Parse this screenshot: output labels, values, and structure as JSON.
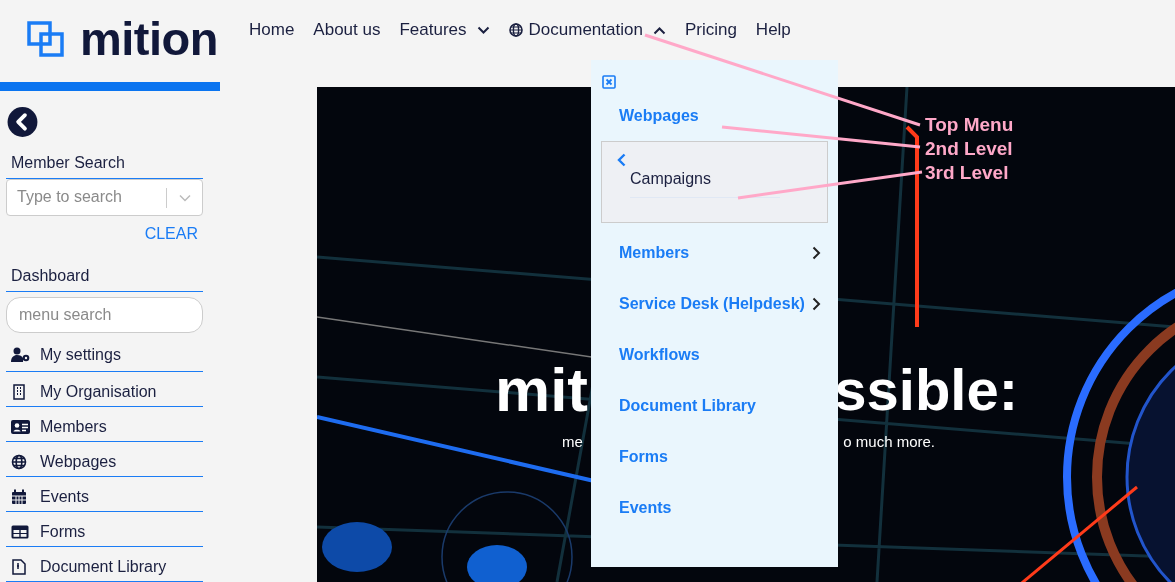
{
  "logo": {
    "text": "mition"
  },
  "nav": [
    {
      "label": "Home",
      "kind": "link"
    },
    {
      "label": "About us",
      "kind": "link"
    },
    {
      "label": "Features",
      "kind": "dropdown",
      "expanded": false
    },
    {
      "label": "Documentation",
      "kind": "globe-dropdown",
      "expanded": true
    },
    {
      "label": "Pricing",
      "kind": "link"
    },
    {
      "label": "Help",
      "kind": "link"
    }
  ],
  "sidebar": {
    "member_search": {
      "label": "Member Search",
      "placeholder": "Type to search"
    },
    "clear": "CLEAR",
    "dashboard": "Dashboard",
    "menu_search": {
      "placeholder": "menu search"
    },
    "items": [
      {
        "label": "My settings",
        "kind": "settings"
      },
      {
        "label": "My Organisation",
        "kind": "organisation"
      },
      {
        "label": "Members",
        "kind": "members"
      },
      {
        "label": "Webpages",
        "kind": "webpages"
      },
      {
        "label": "Events",
        "kind": "events"
      },
      {
        "label": "Forms",
        "kind": "forms"
      },
      {
        "label": "Document Library",
        "kind": "documents"
      }
    ]
  },
  "dropdown": {
    "items": [
      {
        "label": "Webpages",
        "submenu": true,
        "expanded": true,
        "children": [
          {
            "label": "Campaigns"
          }
        ]
      },
      {
        "label": "Members",
        "submenu": true,
        "expanded": false
      },
      {
        "label": "Service Desk (Helpdesk)",
        "submenu": true,
        "expanded": false
      },
      {
        "label": "Workflows",
        "submenu": false
      },
      {
        "label": "Document Library",
        "submenu": false
      },
      {
        "label": "Forms",
        "submenu": false
      },
      {
        "label": "Events",
        "submenu": false
      }
    ]
  },
  "hero": {
    "kind": "picture",
    "headline": [
      "mit",
      "ssible:"
    ],
    "subline": [
      "me",
      "o much more."
    ]
  },
  "annotations": [
    {
      "label": "Top Menu"
    },
    {
      "label": "2nd Level"
    },
    {
      "label": "3rd Level"
    }
  ]
}
